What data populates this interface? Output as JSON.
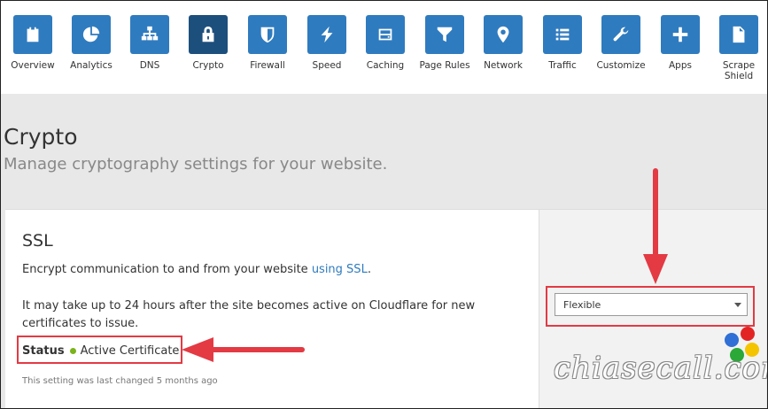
{
  "nav": {
    "items": [
      {
        "label": "Overview",
        "icon": "clipboard-icon"
      },
      {
        "label": "Analytics",
        "icon": "pie-chart-icon"
      },
      {
        "label": "DNS",
        "icon": "network-tree-icon"
      },
      {
        "label": "Crypto",
        "icon": "lock-icon"
      },
      {
        "label": "Firewall",
        "icon": "shield-icon"
      },
      {
        "label": "Speed",
        "icon": "lightning-icon"
      },
      {
        "label": "Caching",
        "icon": "hard-drive-icon"
      },
      {
        "label": "Page Rules",
        "icon": "filter-icon"
      },
      {
        "label": "Network",
        "icon": "map-pin-icon"
      },
      {
        "label": "Traffic",
        "icon": "list-icon"
      },
      {
        "label": "Customize",
        "icon": "wrench-icon"
      },
      {
        "label": "Apps",
        "icon": "plus-icon"
      },
      {
        "label": "Scrape Shield",
        "icon": "document-icon"
      }
    ],
    "active_index": 3
  },
  "header": {
    "title": "Crypto",
    "subtitle": "Manage cryptography settings for your website."
  },
  "ssl": {
    "title": "SSL",
    "desc_prefix": "Encrypt communication to and from your website ",
    "desc_link": "using SSL",
    "desc_suffix": ".",
    "note": "It may take up to 24 hours after the site becomes active on Cloudflare for new certificates to issue.",
    "status_label": "Status",
    "status_value": "Active Certificate",
    "last_changed": "This setting was last changed 5 months ago",
    "select_value": "Flexible"
  },
  "watermark": {
    "text": "chiasecall.com"
  },
  "colors": {
    "tile": "#2f7bbf",
    "tile_active": "#1d4f7c",
    "highlight": "#e33a44",
    "status_ok": "#7bb31a",
    "link": "#2f7bbf"
  }
}
